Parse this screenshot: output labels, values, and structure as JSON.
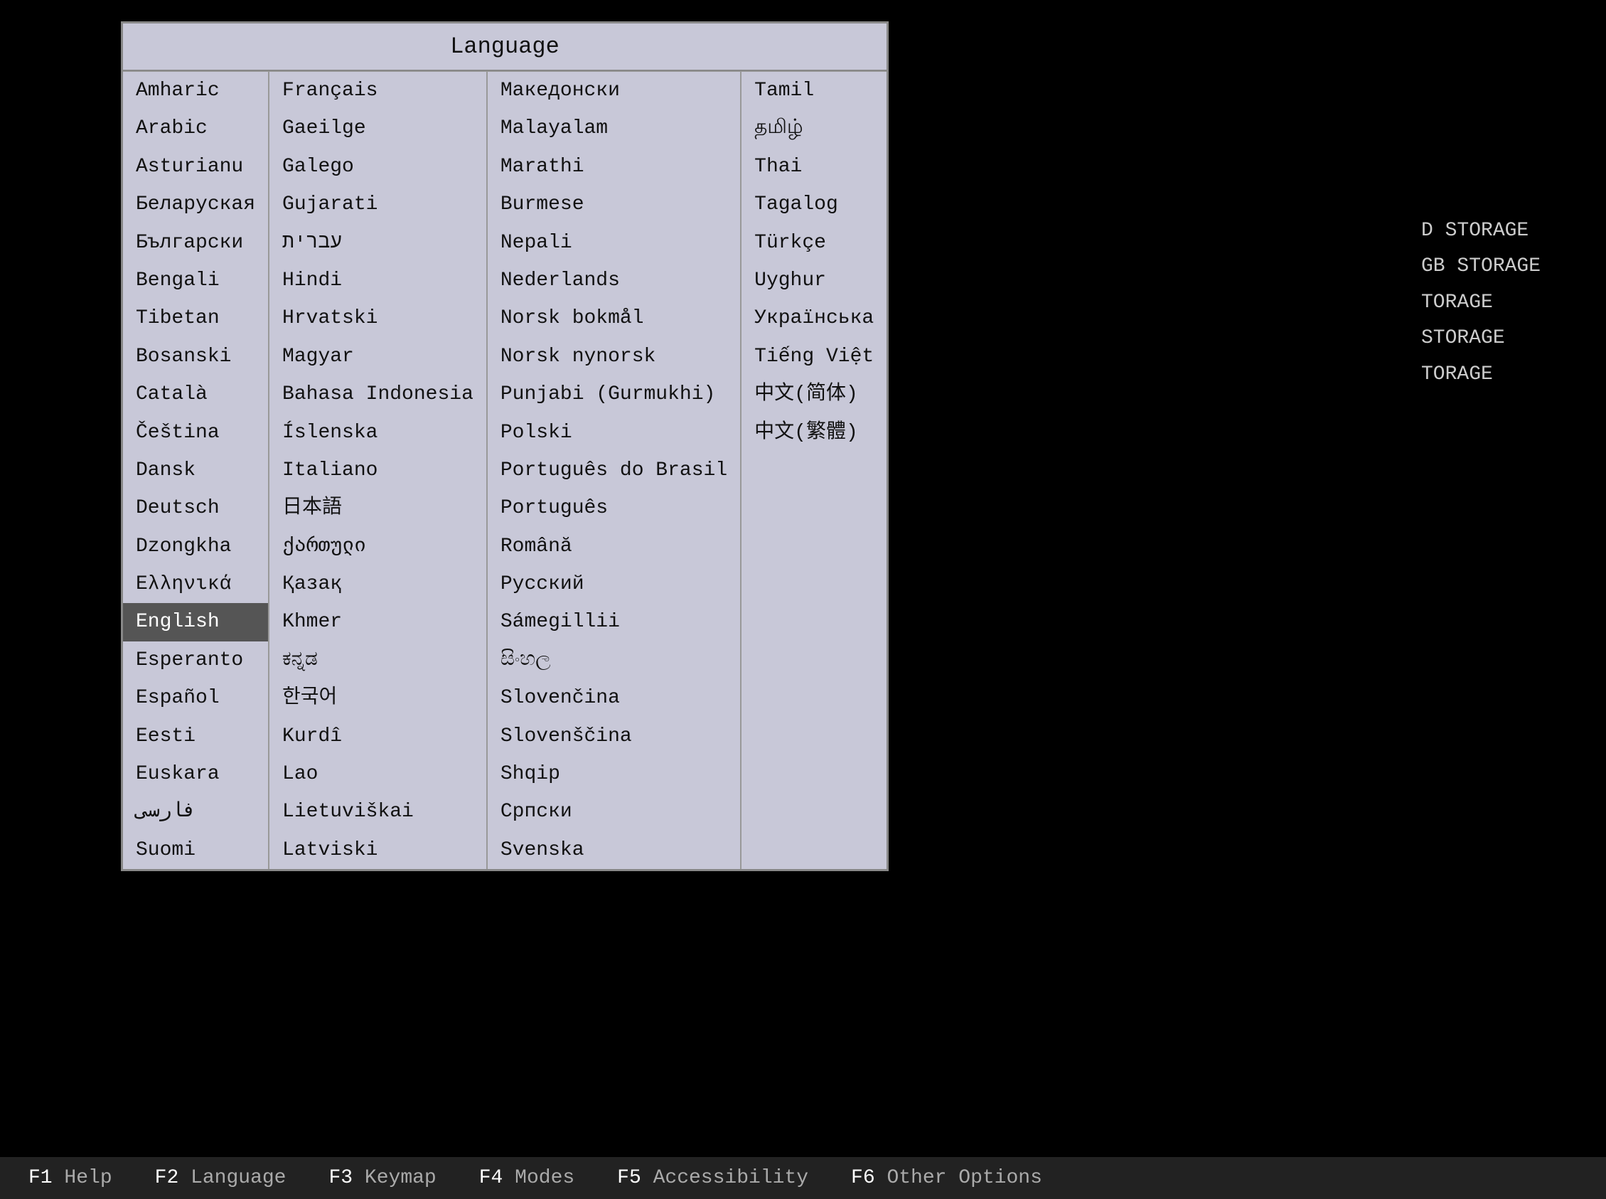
{
  "dialog": {
    "title": "Language"
  },
  "columns": [
    {
      "items": [
        {
          "label": "Amharic",
          "selected": false
        },
        {
          "label": "Arabic",
          "selected": false
        },
        {
          "label": "Asturianu",
          "selected": false
        },
        {
          "label": "Беларуская",
          "selected": false
        },
        {
          "label": "Български",
          "selected": false
        },
        {
          "label": "Bengali",
          "selected": false
        },
        {
          "label": "Tibetan",
          "selected": false
        },
        {
          "label": "Bosanski",
          "selected": false
        },
        {
          "label": "Català",
          "selected": false
        },
        {
          "label": "Čeština",
          "selected": false
        },
        {
          "label": "Dansk",
          "selected": false
        },
        {
          "label": "Deutsch",
          "selected": false
        },
        {
          "label": "Dzongkha",
          "selected": false
        },
        {
          "label": "Ελληνικά",
          "selected": false
        },
        {
          "label": "English",
          "selected": true
        },
        {
          "label": "Esperanto",
          "selected": false
        },
        {
          "label": "Español",
          "selected": false
        },
        {
          "label": "Eesti",
          "selected": false
        },
        {
          "label": "Euskara",
          "selected": false
        },
        {
          "label": "فارسی",
          "selected": false
        },
        {
          "label": "Suomi",
          "selected": false
        }
      ]
    },
    {
      "items": [
        {
          "label": "Français",
          "selected": false
        },
        {
          "label": "Gaeilge",
          "selected": false
        },
        {
          "label": "Galego",
          "selected": false
        },
        {
          "label": "Gujarati",
          "selected": false
        },
        {
          "label": "עברית",
          "selected": false
        },
        {
          "label": "Hindi",
          "selected": false
        },
        {
          "label": "Hrvatski",
          "selected": false
        },
        {
          "label": "Magyar",
          "selected": false
        },
        {
          "label": "Bahasa Indonesia",
          "selected": false
        },
        {
          "label": "Íslenska",
          "selected": false
        },
        {
          "label": "Italiano",
          "selected": false
        },
        {
          "label": "日本語",
          "selected": false
        },
        {
          "label": "ქართული",
          "selected": false
        },
        {
          "label": "Қазақ",
          "selected": false
        },
        {
          "label": "Khmer",
          "selected": false
        },
        {
          "label": "ಕನ್ನಡ",
          "selected": false
        },
        {
          "label": "한국어",
          "selected": false
        },
        {
          "label": "Kurdî",
          "selected": false
        },
        {
          "label": "Lao",
          "selected": false
        },
        {
          "label": "Lietuviškai",
          "selected": false
        },
        {
          "label": "Latviski",
          "selected": false
        }
      ]
    },
    {
      "items": [
        {
          "label": "Македонски",
          "selected": false
        },
        {
          "label": "Malayalam",
          "selected": false
        },
        {
          "label": "Marathi",
          "selected": false
        },
        {
          "label": "Burmese",
          "selected": false
        },
        {
          "label": "Nepali",
          "selected": false
        },
        {
          "label": "Nederlands",
          "selected": false
        },
        {
          "label": "Norsk bokmål",
          "selected": false
        },
        {
          "label": "Norsk nynorsk",
          "selected": false
        },
        {
          "label": "Punjabi (Gurmukhi)",
          "selected": false
        },
        {
          "label": "Polski",
          "selected": false
        },
        {
          "label": "Português do Brasil",
          "selected": false
        },
        {
          "label": "Português",
          "selected": false
        },
        {
          "label": "Română",
          "selected": false
        },
        {
          "label": "Русский",
          "selected": false
        },
        {
          "label": "Sámegillii",
          "selected": false
        },
        {
          "label": " සිංහල",
          "selected": false
        },
        {
          "label": "Slovenčina",
          "selected": false
        },
        {
          "label": "Slovenščina",
          "selected": false
        },
        {
          "label": "Shqip",
          "selected": false
        },
        {
          "label": "Српски",
          "selected": false
        },
        {
          "label": "Svenska",
          "selected": false
        }
      ]
    },
    {
      "items": [
        {
          "label": "Tamil",
          "selected": false
        },
        {
          "label": "தமிழ்",
          "selected": false
        },
        {
          "label": "Thai",
          "selected": false
        },
        {
          "label": "Tagalog",
          "selected": false
        },
        {
          "label": "Türkçe",
          "selected": false
        },
        {
          "label": "Uyghur",
          "selected": false
        },
        {
          "label": "Українська",
          "selected": false
        },
        {
          "label": "Tiếng Việt",
          "selected": false
        },
        {
          "label": "中文(简体)",
          "selected": false
        },
        {
          "label": "中文(繁體)",
          "selected": false
        }
      ]
    }
  ],
  "right_panel": {
    "items": [
      "D STORAGE",
      "GB STORAGE",
      "TORAGE",
      "STORAGE",
      "TORAGE"
    ]
  },
  "bottom_bar": {
    "keys": [
      {
        "key": "F1",
        "label": "Help"
      },
      {
        "key": "F2",
        "label": "Language"
      },
      {
        "key": "F3",
        "label": "Keymap"
      },
      {
        "key": "F4",
        "label": "Modes"
      },
      {
        "key": "F5",
        "label": "Accessibility"
      },
      {
        "key": "F6",
        "label": "Other Options"
      }
    ]
  }
}
